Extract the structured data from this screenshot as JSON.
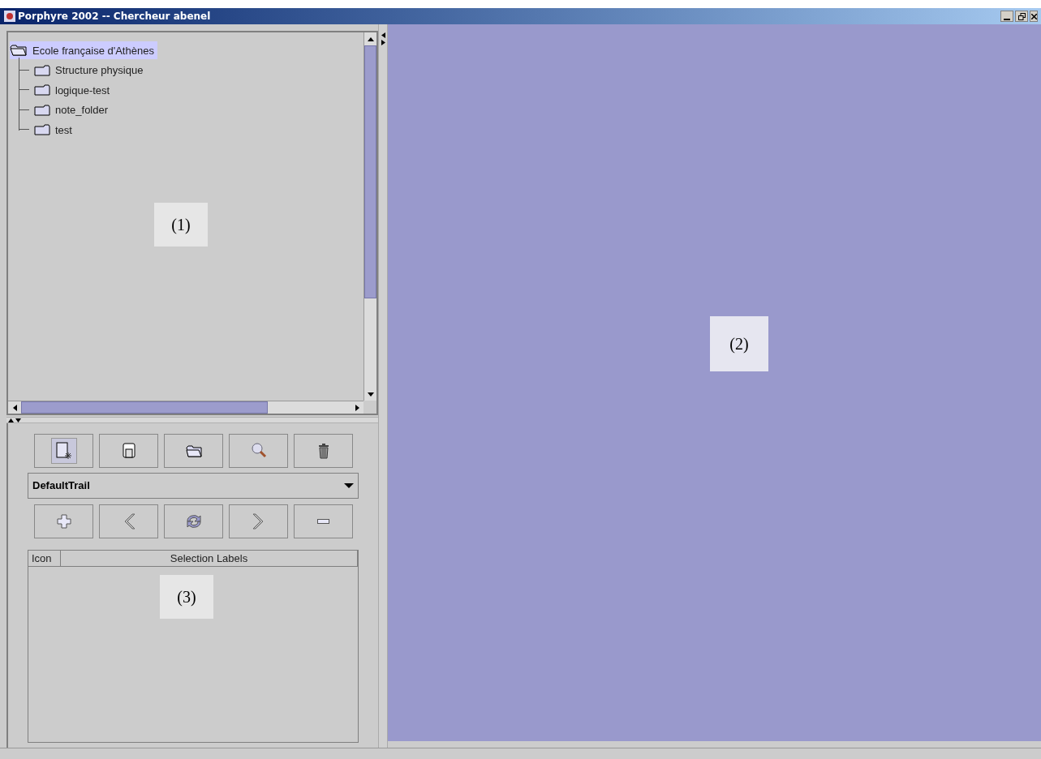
{
  "window": {
    "title": "Porphyre 2002 -- Chercheur abenel"
  },
  "tree": {
    "label": "Ecole française d'Athènes",
    "selected": true,
    "expanded": true,
    "children": [
      {
        "label": "Structure physique",
        "selected": false
      },
      {
        "label": "logique-test",
        "selected": false
      },
      {
        "label": "note_folder",
        "selected": false
      },
      {
        "label": "test",
        "selected": false
      }
    ]
  },
  "tree_annotation": "(1)",
  "toolbar": [
    {
      "kind": "new"
    },
    {
      "kind": "window"
    },
    {
      "kind": "folder"
    },
    {
      "kind": "search"
    },
    {
      "kind": "trash"
    }
  ],
  "trail": {
    "value": "DefaultTrail"
  },
  "trail_buttons": [
    {
      "kind": "add"
    },
    {
      "kind": "back"
    },
    {
      "kind": "refresh"
    },
    {
      "kind": "forward"
    },
    {
      "kind": "remove"
    }
  ],
  "table": {
    "columns": [
      "Icon",
      "Selection Labels"
    ]
  },
  "table_annotation": "(3)",
  "workspace_annotation": "(2)"
}
